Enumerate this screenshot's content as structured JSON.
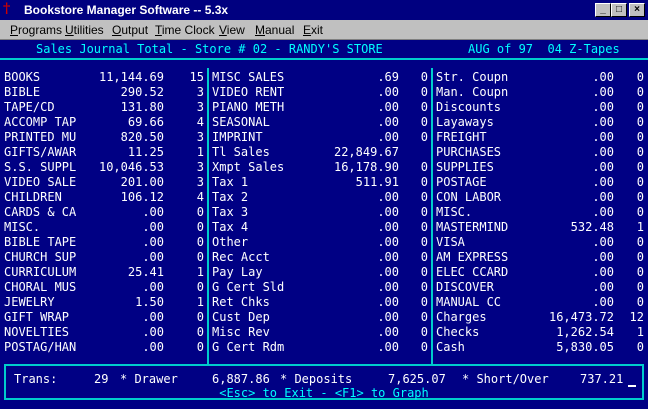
{
  "window": {
    "title": "Bookstore Manager Software -- 5.3x",
    "buttons": {
      "minimize": "_",
      "maximize": "□",
      "close": "×"
    }
  },
  "menu": [
    "Programs",
    "Utilities",
    "Output",
    "Time Clock",
    "View",
    "Manual",
    "Exit"
  ],
  "header": {
    "left": "Sales Journal Total - Store # 02 - RANDY'S STORE",
    "right": "AUG of 97  04 Z-Tapes"
  },
  "col1": [
    {
      "label": "BOOKS",
      "amount": "11,144.69",
      "count": "15"
    },
    {
      "label": "BIBLE",
      "amount": "290.52",
      "count": "3"
    },
    {
      "label": "TAPE/CD",
      "amount": "131.80",
      "count": "3"
    },
    {
      "label": "ACCOMP TAP",
      "amount": "69.66",
      "count": "4"
    },
    {
      "label": "PRINTED MU",
      "amount": "820.50",
      "count": "3"
    },
    {
      "label": "GIFTS/AWAR",
      "amount": "11.25",
      "count": "1"
    },
    {
      "label": "S.S. SUPPL",
      "amount": "10,046.53",
      "count": "3"
    },
    {
      "label": "VIDEO SALE",
      "amount": "201.00",
      "count": "3"
    },
    {
      "label": "CHILDREN",
      "amount": "106.12",
      "count": "4"
    },
    {
      "label": "CARDS & CA",
      "amount": ".00",
      "count": "0"
    },
    {
      "label": "MISC.",
      "amount": ".00",
      "count": "0"
    },
    {
      "label": "BIBLE TAPE",
      "amount": ".00",
      "count": "0"
    },
    {
      "label": "CHURCH SUP",
      "amount": ".00",
      "count": "0"
    },
    {
      "label": "CURRICULUM",
      "amount": "25.41",
      "count": "1"
    },
    {
      "label": "CHORAL MUS",
      "amount": ".00",
      "count": "0"
    },
    {
      "label": "JEWELRY",
      "amount": "1.50",
      "count": "1"
    },
    {
      "label": "GIFT WRAP",
      "amount": ".00",
      "count": "0"
    },
    {
      "label": "NOVELTIES",
      "amount": ".00",
      "count": "0"
    },
    {
      "label": "POSTAG/HAN",
      "amount": ".00",
      "count": "0"
    }
  ],
  "col2": [
    {
      "label": "MISC SALES",
      "amount": ".69",
      "count": "0"
    },
    {
      "label": "VIDEO RENT",
      "amount": ".00",
      "count": "0"
    },
    {
      "label": "PIANO METH",
      "amount": ".00",
      "count": "0"
    },
    {
      "label": "SEASONAL",
      "amount": ".00",
      "count": "0"
    },
    {
      "label": "IMPRINT",
      "amount": ".00",
      "count": "0"
    },
    {
      "label": "Tl Sales",
      "amount": "22,849.67",
      "count": ""
    },
    {
      "label": "Xmpt Sales",
      "amount": "16,178.90",
      "count": "0"
    },
    {
      "label": "Tax 1",
      "amount": "511.91",
      "count": "0"
    },
    {
      "label": "Tax 2",
      "amount": ".00",
      "count": "0"
    },
    {
      "label": "Tax 3",
      "amount": ".00",
      "count": "0"
    },
    {
      "label": "Tax 4",
      "amount": ".00",
      "count": "0"
    },
    {
      "label": "Other",
      "amount": ".00",
      "count": "0"
    },
    {
      "label": "Rec Acct",
      "amount": ".00",
      "count": "0"
    },
    {
      "label": "Pay Lay",
      "amount": ".00",
      "count": "0"
    },
    {
      "label": "G Cert Sld",
      "amount": ".00",
      "count": "0"
    },
    {
      "label": "Ret Chks",
      "amount": ".00",
      "count": "0"
    },
    {
      "label": "Cust Dep",
      "amount": ".00",
      "count": "0"
    },
    {
      "label": "Misc Rev",
      "amount": ".00",
      "count": "0"
    },
    {
      "label": "G Cert Rdm",
      "amount": ".00",
      "count": "0"
    }
  ],
  "col3": [
    {
      "label": "Str. Coupn",
      "amount": ".00",
      "count": "0"
    },
    {
      "label": "Man. Coupn",
      "amount": ".00",
      "count": "0"
    },
    {
      "label": "Discounts",
      "amount": ".00",
      "count": "0"
    },
    {
      "label": "Layaways",
      "amount": ".00",
      "count": "0"
    },
    {
      "label": "FREIGHT",
      "amount": ".00",
      "count": "0"
    },
    {
      "label": "PURCHASES",
      "amount": ".00",
      "count": "0"
    },
    {
      "label": "SUPPLIES",
      "amount": ".00",
      "count": "0"
    },
    {
      "label": "POSTAGE",
      "amount": ".00",
      "count": "0"
    },
    {
      "label": "CON LABOR",
      "amount": ".00",
      "count": "0"
    },
    {
      "label": "MISC.",
      "amount": ".00",
      "count": "0"
    },
    {
      "label": "MASTERMIND",
      "amount": "532.48",
      "count": "1"
    },
    {
      "label": "VISA",
      "amount": ".00",
      "count": "0"
    },
    {
      "label": "AM EXPRESS",
      "amount": ".00",
      "count": "0"
    },
    {
      "label": "ELEC CCARD",
      "amount": ".00",
      "count": "0"
    },
    {
      "label": "DISCOVER",
      "amount": ".00",
      "count": "0"
    },
    {
      "label": "MANUAL CC",
      "amount": ".00",
      "count": "0"
    },
    {
      "label": "Charges",
      "amount": "16,473.72",
      "count": "12"
    },
    {
      "label": "Checks",
      "amount": "1,262.54",
      "count": "1"
    },
    {
      "label": "Cash",
      "amount": "5,830.05",
      "count": "0"
    }
  ],
  "summary": {
    "trans_label": "Trans:",
    "trans_value": "29",
    "drawer_label": "* Drawer",
    "drawer_value": "6,887.86",
    "deposits_label": "* Deposits",
    "deposits_value": "7,625.07",
    "short_over_label": "* Short/Over",
    "short_over_value": "737.21"
  },
  "footer": "<Esc> to Exit - <F1> to Graph"
}
